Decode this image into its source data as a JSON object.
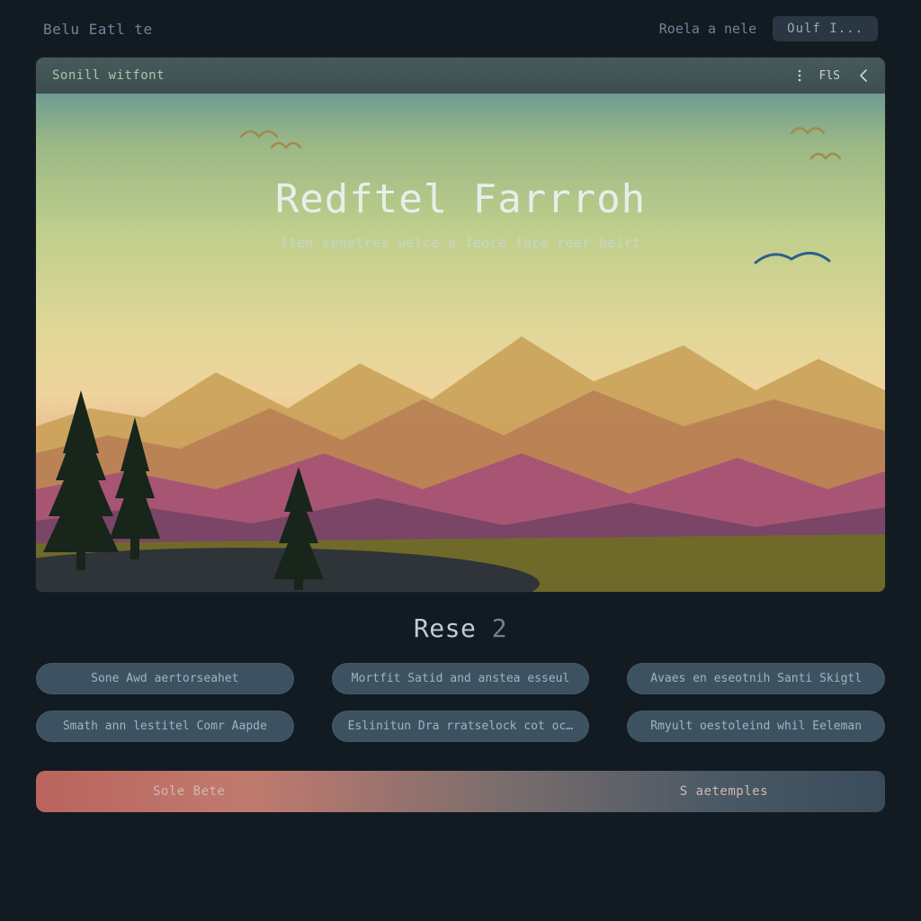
{
  "header": {
    "brand": "Belu Eatl te",
    "link": "Roela a nele",
    "button": "Oulf I..."
  },
  "panel": {
    "title": "Sonill witfont",
    "fls": "FlS",
    "icons": {
      "more": "more-vertical-icon",
      "back": "chevron-left-icon"
    }
  },
  "hero": {
    "title": "Redftel Farrroh",
    "subtitle": "ften senetres welce a feore face reer heirt"
  },
  "section": {
    "label": "Rese ",
    "number": "2"
  },
  "chips": [
    "Sone  Awd aertorseahet",
    "Mortfit Satid and anstea esseul",
    "Avaes en eseotnih Santi Skigtl",
    "Smath ann lestitel Comr  Aapde",
    "Eslinitun   Dra rratselock cot ocees",
    "Rmyult  oestoleind whil Eeleman"
  ],
  "bottom": {
    "left": "Sole Bete",
    "right": "S aetemples"
  }
}
